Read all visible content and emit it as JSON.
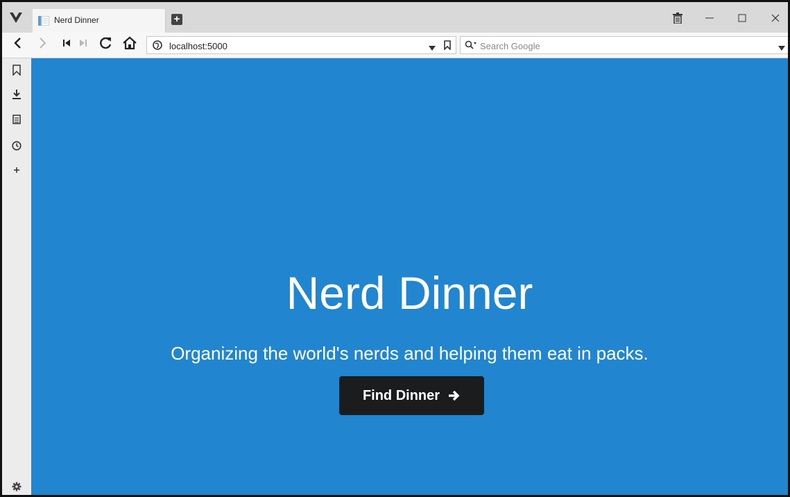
{
  "browser": {
    "tab_title": "Nerd Dinner",
    "url": "localhost:5000",
    "search_placeholder": "Search Google"
  },
  "hero": {
    "title": "Nerd Dinner",
    "subtitle": "Organizing the world's nerds and helping them eat in packs.",
    "button_label": "Find Dinner"
  },
  "icons": {
    "brand": "vivaldi-logo-icon",
    "tab_favicon": "page-icon",
    "new_tab": "plus-icon",
    "trash": "trash-icon",
    "minimize": "minimize-icon",
    "maximize": "maximize-icon",
    "close": "close-icon",
    "back": "back-arrow-icon",
    "forward": "forward-arrow-icon",
    "rewind": "rewind-icon",
    "fast_forward": "fast-forward-icon",
    "reload": "reload-icon",
    "home": "home-icon",
    "site_info": "globe-icon",
    "url_dropdown": "dropdown-icon",
    "bookmark": "bookmark-icon",
    "search_engine": "search-icon",
    "search_dropdown": "dropdown-icon",
    "side_bookmarks": "bookmark-icon",
    "side_downloads": "download-icon",
    "side_notes": "notes-icon",
    "side_history": "history-icon",
    "side_add": "add-panel-icon",
    "settings": "gear-icon",
    "button_arrow": "arrow-right-icon"
  },
  "colors": {
    "hero_background": "#2185d0",
    "button_background": "#1b1c1d",
    "text_on_hero": "#ffffff"
  }
}
